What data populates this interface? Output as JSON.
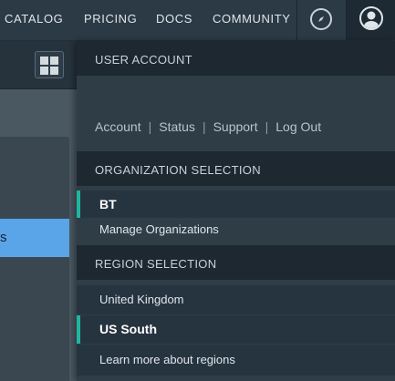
{
  "nav": {
    "links": [
      "CATALOG",
      "PRICING",
      "DOCS",
      "COMMUNITY"
    ]
  },
  "icons": {
    "compass": "compass-icon",
    "avatar": "user-avatar-icon",
    "grid": "grid-icon"
  },
  "left": {
    "selected_item_partial": "s"
  },
  "dropdown": {
    "user_account_header": "USER ACCOUNT",
    "account_links": [
      "Account",
      "Status",
      "Support",
      "Log Out"
    ],
    "separator": "|",
    "org_header": "ORGANIZATION SELECTION",
    "org_current": "BT",
    "manage_orgs": "Manage Organizations",
    "region_header": "REGION SELECTION",
    "regions": [
      "United Kingdom",
      "US South"
    ],
    "selected_region": "US South",
    "learn_more": "Learn more about regions"
  },
  "colors": {
    "accent": "#1fb6a0",
    "selected_blue": "#5aa5e8"
  }
}
